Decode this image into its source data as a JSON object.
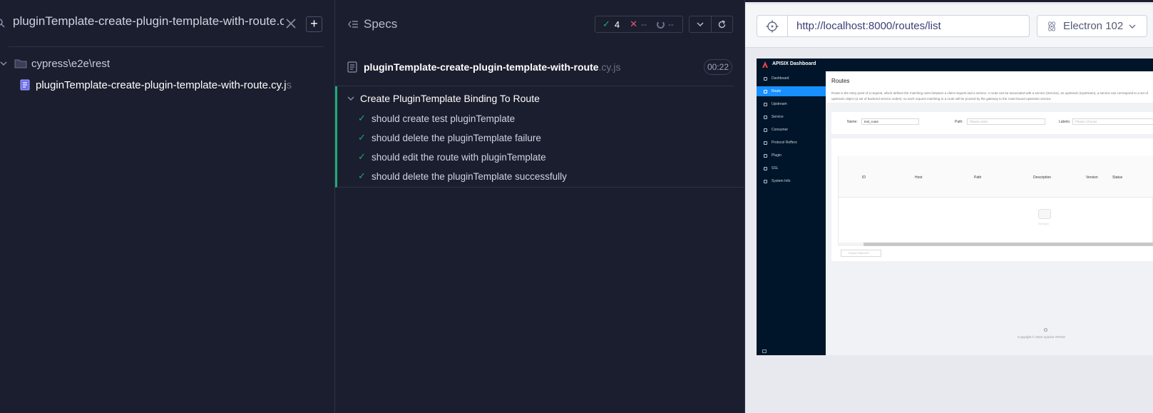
{
  "spec_list": {
    "search_value": "pluginTemplate-create-plugin-template-with-route.cy",
    "add_label": "+",
    "folder": "cypress\\e2e\\rest",
    "spec_file": "pluginTemplate-create-plugin-template-with-route.cy.j",
    "spec_file_ext": "s"
  },
  "reporter": {
    "title": "Specs",
    "passed": "4",
    "failed": "--",
    "pending": "--",
    "file_name": "pluginTemplate-create-plugin-template-with-route",
    "file_ext": ".cy.js",
    "duration": "00:22",
    "suite_title": "Create PluginTemplate Binding To Route",
    "tests": [
      "should create test pluginTemplate",
      "should delete the pluginTemplate failure",
      "should edit the route with pluginTemplate",
      "should delete the pluginTemplate successfully"
    ]
  },
  "aut": {
    "url": "http://localhost:8000/routes/list",
    "browser": "Electron 102"
  },
  "dashboard": {
    "brand": "APISIX Dashboard",
    "nav": [
      "Dashboard",
      "Route",
      "Upstream",
      "Service",
      "Consumer",
      "Protocol Reffers",
      "Plugin",
      "SSL",
      "System Info"
    ],
    "active_nav": "Route",
    "page_title": "Routes",
    "description": "Route is the entry point of a request, which defines the matching rules between a client request and a service. A route can be associated with a service (Service), an upstream (Upstream), a service can correspond to a set of upstream object (a set of backend service nodes), so each request matching to a route will be proxied by the gateway to the route-bound upstream service.",
    "filter": {
      "name_label": "Name:",
      "name_value": "test_route",
      "path_label": "Path:",
      "path_placeholder": "Please enter",
      "labels_label": "Labels:",
      "labels_placeholder": "Please Choose"
    },
    "columns": [
      "ID",
      "Host",
      "Path",
      "Description",
      "Version",
      "Status"
    ],
    "empty_text": "No Data",
    "export_label": "Export OpenAPI",
    "footer": "Copyright © 2022 Apache APISIX"
  },
  "colors": {
    "pass": "#1fa971",
    "fail": "#e45770",
    "accent": "#1890ff",
    "panel_bg": "#1b1e2e"
  }
}
